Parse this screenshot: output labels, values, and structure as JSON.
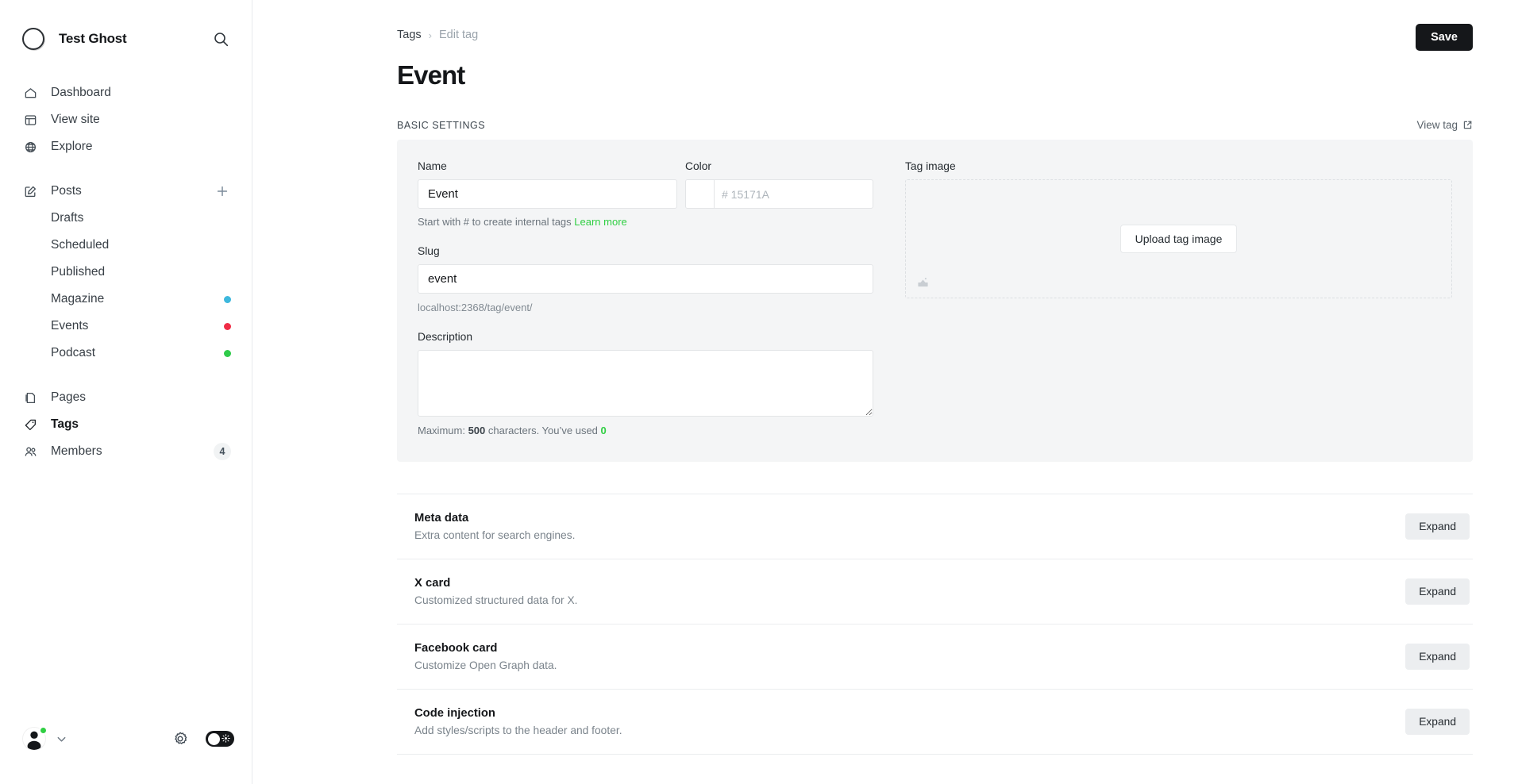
{
  "sidebar": {
    "site_name": "Test Ghost",
    "search_icon": "search-icon",
    "nav_groups": [
      {
        "items": [
          {
            "label": "Dashboard",
            "icon": "home-icon"
          },
          {
            "label": "View site",
            "icon": "layout-icon"
          },
          {
            "label": "Explore",
            "icon": "globe-icon"
          }
        ]
      },
      {
        "items": [
          {
            "label": "Posts",
            "icon": "pencil-square-icon",
            "action": "plus-icon"
          },
          {
            "label": "Drafts",
            "sub": true
          },
          {
            "label": "Scheduled",
            "sub": true
          },
          {
            "label": "Published",
            "sub": true
          },
          {
            "label": "Magazine",
            "sub": true,
            "dot": "#3eb8dd"
          },
          {
            "label": "Events",
            "sub": true,
            "dot": "#f02c46"
          },
          {
            "label": "Podcast",
            "sub": true,
            "dot": "#2fcb4a"
          }
        ]
      },
      {
        "items": [
          {
            "label": "Pages",
            "icon": "pages-icon"
          },
          {
            "label": "Tags",
            "icon": "tag-icon",
            "active": true
          },
          {
            "label": "Members",
            "icon": "members-icon",
            "badge": "4"
          }
        ]
      }
    ],
    "footer": {
      "avatar_icon": "avatar",
      "status_dot_color": "#30cf43",
      "chevron_icon": "chevron-down-icon",
      "gear_icon": "gear-icon",
      "dark_mode_toggle": {
        "state": "off",
        "glyph_icon": "sun-icon",
        "track_color": "#15171a"
      }
    }
  },
  "header": {
    "breadcrumb": {
      "parent": "Tags",
      "separator": "›",
      "current": "Edit tag"
    },
    "save_label": "Save",
    "title": "Event"
  },
  "basic": {
    "section_label": "BASIC SETTINGS",
    "view_tag_label": "View tag",
    "view_tag_icon": "external-link-icon",
    "name": {
      "label": "Name",
      "value": "Event",
      "placeholder": "",
      "help_prefix": "Start with # to create internal tags ",
      "help_link": "Learn more",
      "help_link_color": "#30cf43"
    },
    "color": {
      "label": "Color",
      "value": "",
      "placeholder": "# 15171A",
      "swatch_color": "#ffffff"
    },
    "slug": {
      "label": "Slug",
      "value": "event",
      "placeholder": "",
      "url_hint": "localhost:2368/tag/event/"
    },
    "description": {
      "label": "Description",
      "value": "",
      "placeholder": "",
      "limit_prefix": "Maximum: ",
      "limit_max": "500",
      "limit_mid": " characters. You’ve used ",
      "limit_used": "0"
    },
    "tag_image": {
      "label": "Tag image",
      "upload_label": "Upload tag image",
      "corner_icon": "image-icon"
    }
  },
  "sections": [
    {
      "title": "Meta data",
      "subtitle": "Extra content for search engines.",
      "button": "Expand"
    },
    {
      "title": "X card",
      "subtitle": "Customized structured data for X.",
      "button": "Expand"
    },
    {
      "title": "Facebook card",
      "subtitle": "Customize Open Graph data.",
      "button": "Expand"
    },
    {
      "title": "Code injection",
      "subtitle": "Add styles/scripts to the header and footer.",
      "button": "Expand"
    }
  ]
}
